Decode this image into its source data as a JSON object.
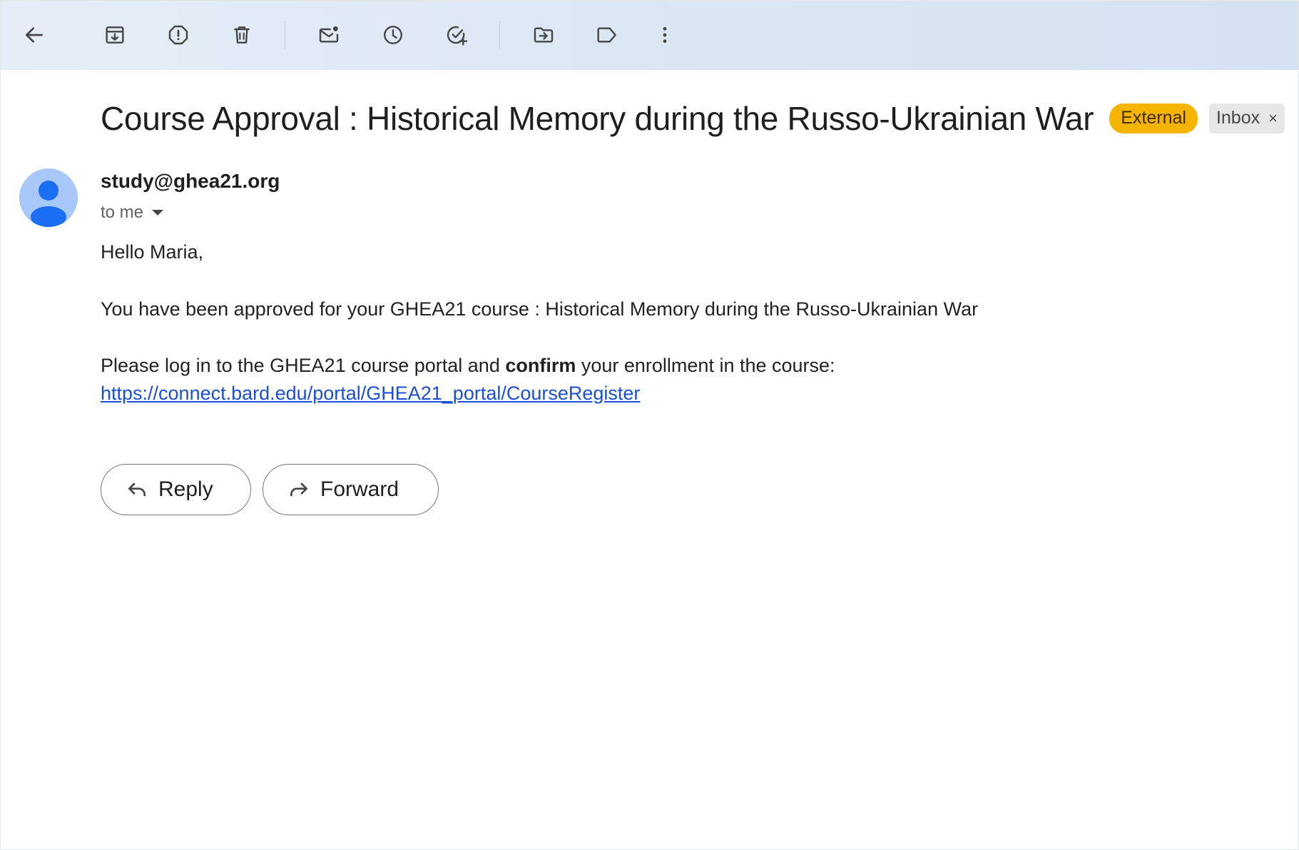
{
  "toolbar": {
    "buttons": [
      {
        "icon": "back-arrow-icon"
      },
      {
        "icon": "archive-icon"
      },
      {
        "icon": "report-spam-icon"
      },
      {
        "icon": "delete-icon"
      },
      {
        "icon": "mark-unread-icon"
      },
      {
        "icon": "snooze-icon"
      },
      {
        "icon": "add-to-tasks-icon"
      },
      {
        "icon": "move-to-icon"
      },
      {
        "icon": "label-icon"
      },
      {
        "icon": "more-options-icon"
      }
    ]
  },
  "email": {
    "subject": "Course Approval : Historical Memory during the Russo-Ukrainian War",
    "badges": {
      "external": "External",
      "inbox": "Inbox",
      "inbox_close": "×"
    },
    "sender": "study@ghea21.org",
    "recipient_label": "to me",
    "greeting": "Hello Maria,",
    "line1": "You have been approved for your GHEA21 course : Historical Memory during the Russo-Ukrainian War",
    "line2_before": "Please log in to the GHEA21 course portal and ",
    "line2_bold": "confirm",
    "line2_after": " your enrollment in the course:",
    "link": "https://connect.bard.edu/portal/GHEA21_portal/CourseRegister"
  },
  "actions": {
    "reply_label": "Reply",
    "forward_label": "Forward"
  },
  "colors": {
    "external_badge": "#f4b400",
    "inbox_badge": "#e6e7e9",
    "link": "#1a4fd6",
    "avatar_bg": "#a8c7fa",
    "avatar_fg": "#1b6ef3"
  }
}
